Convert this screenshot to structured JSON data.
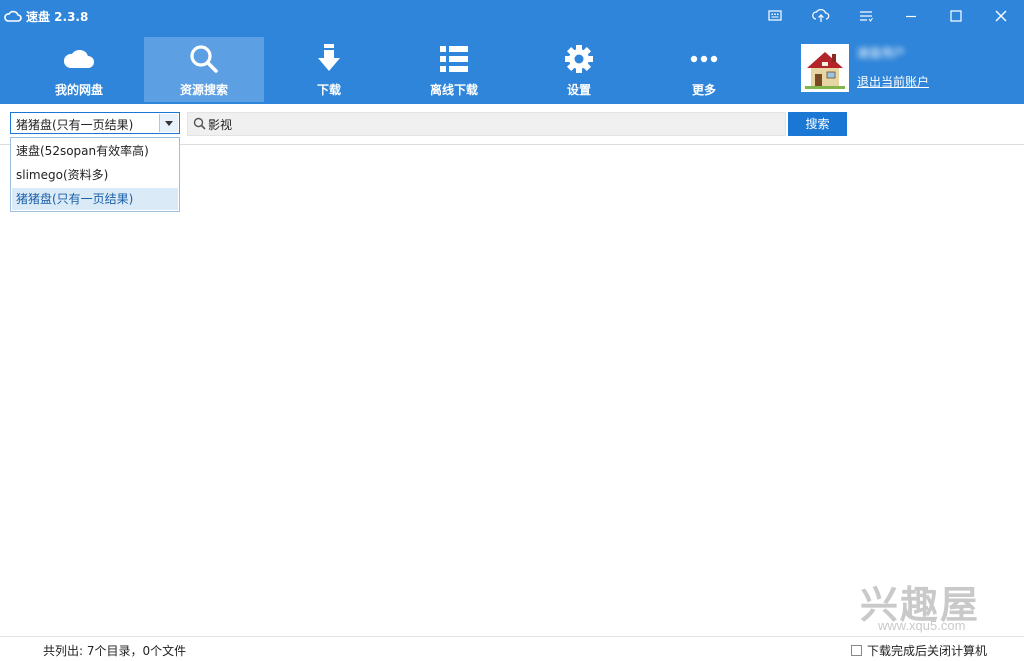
{
  "app": {
    "title": "速盘 2.3.8"
  },
  "titlebar": {
    "buttons": [
      {
        "name": "feedback-icon"
      },
      {
        "name": "upload-icon"
      },
      {
        "name": "menu-icon"
      },
      {
        "name": "minimize-icon"
      },
      {
        "name": "maximize-icon"
      },
      {
        "name": "close-icon"
      }
    ]
  },
  "toolbar": {
    "items": [
      {
        "label": "我的网盘",
        "icon": "cloud-icon"
      },
      {
        "label": "资源搜索",
        "icon": "search-icon",
        "active": true
      },
      {
        "label": "下载",
        "icon": "download-arrow-icon"
      },
      {
        "label": "离线下载",
        "icon": "list-icon"
      },
      {
        "label": "设置",
        "icon": "gear-icon"
      },
      {
        "label": "更多",
        "icon": "more-dots-icon"
      }
    ]
  },
  "user": {
    "name": "速盘用户",
    "logout_label": "退出当前账户",
    "avatar_icon": "house-avatar-icon"
  },
  "search": {
    "source_selected": "猪猪盘(只有一页结果)",
    "source_options": [
      "速盘(52sopan有效率高)",
      "slimego(资料多)",
      "猪猪盘(只有一页结果)"
    ],
    "query_value": "影视",
    "button_label": "搜索"
  },
  "status": {
    "summary": "共列出: 7个目录，0个文件",
    "shutdown_label": "下载完成后关闭计算机",
    "shutdown_checked": false
  },
  "watermark": {
    "text": "兴趣屋",
    "url": "www.xqu5.com"
  },
  "colors": {
    "header": "#2f85d9",
    "active_tab": "#5c9fe2",
    "accent": "#1a78d4"
  }
}
